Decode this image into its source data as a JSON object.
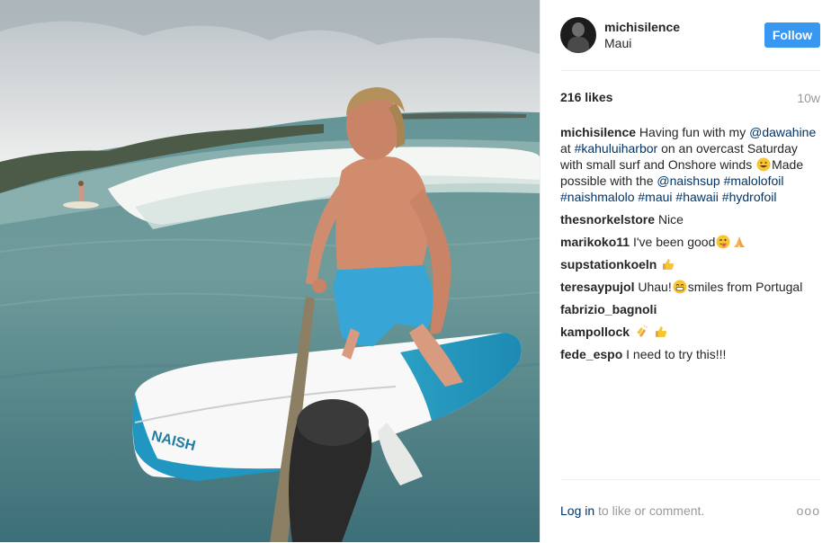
{
  "post": {
    "image_alt": "man paddleboarding on a foil board",
    "board_brand": "NAISH"
  },
  "header": {
    "username": "michisilence",
    "location": "Maui",
    "follow_label": "Follow"
  },
  "stats": {
    "likes": "216 likes",
    "age": "10w"
  },
  "caption": {
    "user": "michisilence",
    "p1": " Having fun with my ",
    "mention1": "@dawahine",
    "p2": " at ",
    "tag1": "#kahuluiharbor",
    "p3": " on an overcast Saturday with small surf and Onshore winds ",
    "p4": "Made possible with the ",
    "mention2": "@naishsup",
    "tag2": "#malolofoil",
    "tag3": "#naishmalolo",
    "tag4": "#maui",
    "tag5": "#hawaii",
    "tag6": "#hydrofoil"
  },
  "comments": [
    {
      "user": "thesnorkelstore",
      "text": "Nice"
    },
    {
      "user": "marikoko11",
      "text": "I've been good"
    },
    {
      "user": "supstationkoeln",
      "text": ""
    },
    {
      "user": "teresaypujol",
      "text_a": "Uhau!",
      "text_b": "smiles from Portugal"
    },
    {
      "user": "fabrizio_bagnoli",
      "text": ""
    },
    {
      "user": "kampollock",
      "text": ""
    },
    {
      "user": "fede_espo",
      "text": "I need to try this!!!"
    }
  ],
  "footer": {
    "login_link": "Log in",
    "login_rest": " to like or comment.",
    "more": "ooo"
  },
  "icons": {
    "grin": "grinning-face-emoji",
    "wink": "winking-tongue-emoji",
    "pray": "folded-hands-emoji",
    "thumb": "thumbs-up-emoji",
    "clap": "clapping-hands-emoji"
  },
  "colors": {
    "follow_bg": "#3897f0",
    "link": "#003569",
    "muted": "#999999",
    "text": "#262626"
  }
}
